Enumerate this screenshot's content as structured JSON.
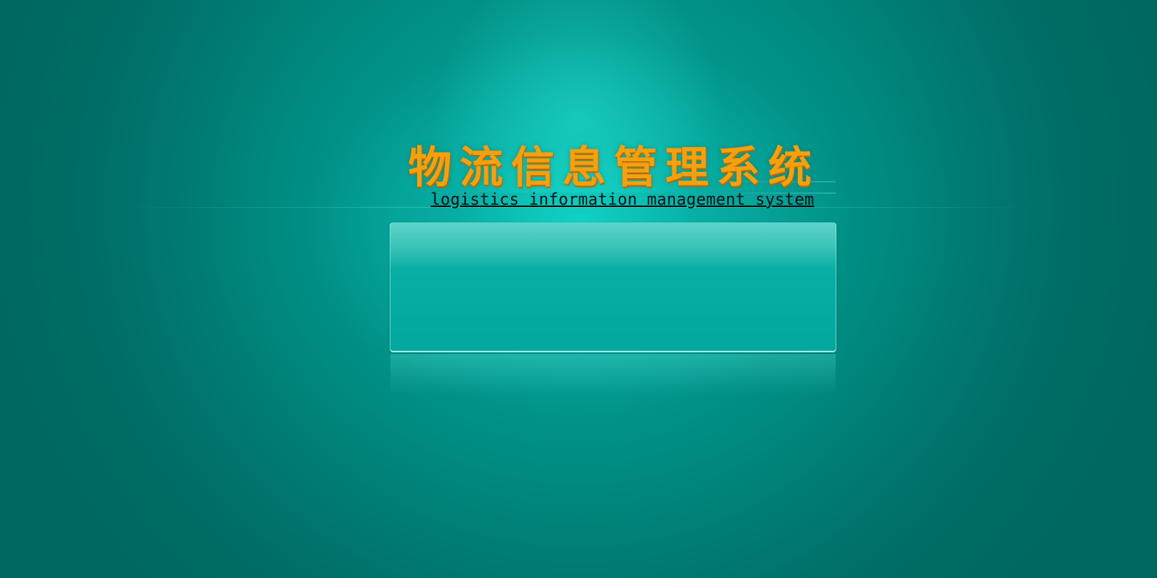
{
  "app": {
    "title": "物流信息管理系统",
    "subtitle": "logistics information management system"
  },
  "colors": {
    "background": "#008c82",
    "glow": "#10d6c8",
    "title": "#f5a00e",
    "subtitle": "#0b1111",
    "panel": "#02a89e"
  }
}
